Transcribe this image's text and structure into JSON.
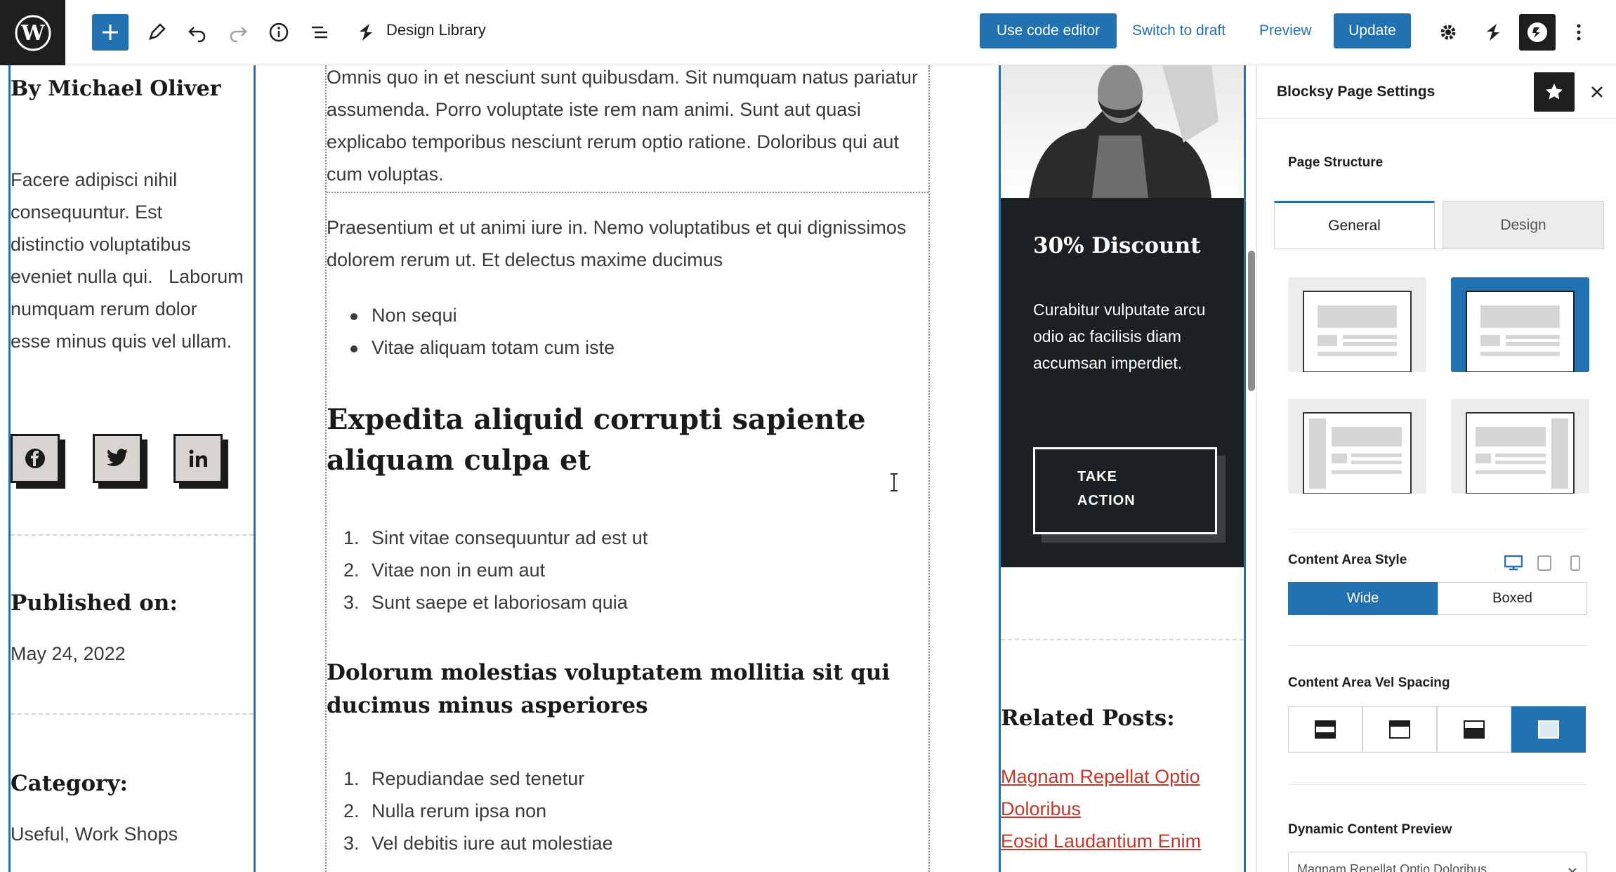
{
  "toolbar": {
    "design_library_label": "Design Library",
    "use_code_editor_label": "Use code editor",
    "switch_to_draft_label": "Switch to draft",
    "preview_label": "Preview",
    "update_label": "Update"
  },
  "left": {
    "author": "By Michael Oliver",
    "paragraph_lines": [
      "Facere adipisci nihil",
      "consequuntur. Est",
      "distinctio voluptatibus",
      "eveniet nulla qui.   Laborum",
      "numquam rerum dolor",
      "esse minus quis vel ullam."
    ],
    "published_heading": "Published on:",
    "published_date": "May 24, 2022",
    "category_heading": "Category:",
    "categories": "Useful, Work Shops"
  },
  "main": {
    "para1": "Omnis quo in et nesciunt sunt quibusdam. Sit numquam natus pariatur assumenda. Porro voluptate iste rem nam animi. Sunt aut quasi explicabo temporibus nesciunt rerum optio ratione. Doloribus qui aut cum voluptas.",
    "para2": "Praesentium et ut animi iure in. Nemo voluptatibus et qui dignissimos dolorem rerum ut. Et delectus maxime ducimus",
    "bullets": [
      "Non sequi",
      "Vitae aliquam totam cum iste"
    ],
    "heading2": "Expedita aliquid corrupti sapiente aliquam culpa et",
    "ordered1": [
      "Sint vitae consequuntur ad est ut",
      "Vitae non in eum aut",
      "Sunt saepe et laboriosam quia"
    ],
    "heading3": "Dolorum molestias voluptatem mollitia sit qui ducimus minus asperiores",
    "ordered2": [
      "Repudiandae sed tenetur",
      "Nulla rerum ipsa non",
      "Vel debitis iure aut molestiae"
    ],
    "numbers": [
      "1.",
      "2.",
      "3."
    ]
  },
  "right": {
    "promo_title": "30% Discount",
    "promo_text": "Curabitur vulputate arcu odio ac facilisis diam accumsan imperdiet.",
    "promo_button_line1": "TAKE",
    "promo_button_line2": "ACTION",
    "related_heading": "Related Posts:",
    "related_links": [
      "Magnam Repellat Optio",
      "Doloribus",
      "Eosid Laudantium Enim"
    ]
  },
  "sidebar": {
    "title": "Blocksy Page Settings",
    "page_structure_label": "Page Structure",
    "tabs": [
      "General",
      "Design"
    ],
    "content_area_style_label": "Content Area Style",
    "style_options": [
      "Wide",
      "Boxed"
    ],
    "vel_spacing_label": "Content Area Vel Spacing",
    "dynamic_preview_label": "Dynamic Content Preview",
    "dynamic_preview_value": "Magnam Repellat Optio Doloribus"
  },
  "colors": {
    "accent": "#2271b1",
    "dark": "#1d2023",
    "link": "#c0392b"
  }
}
